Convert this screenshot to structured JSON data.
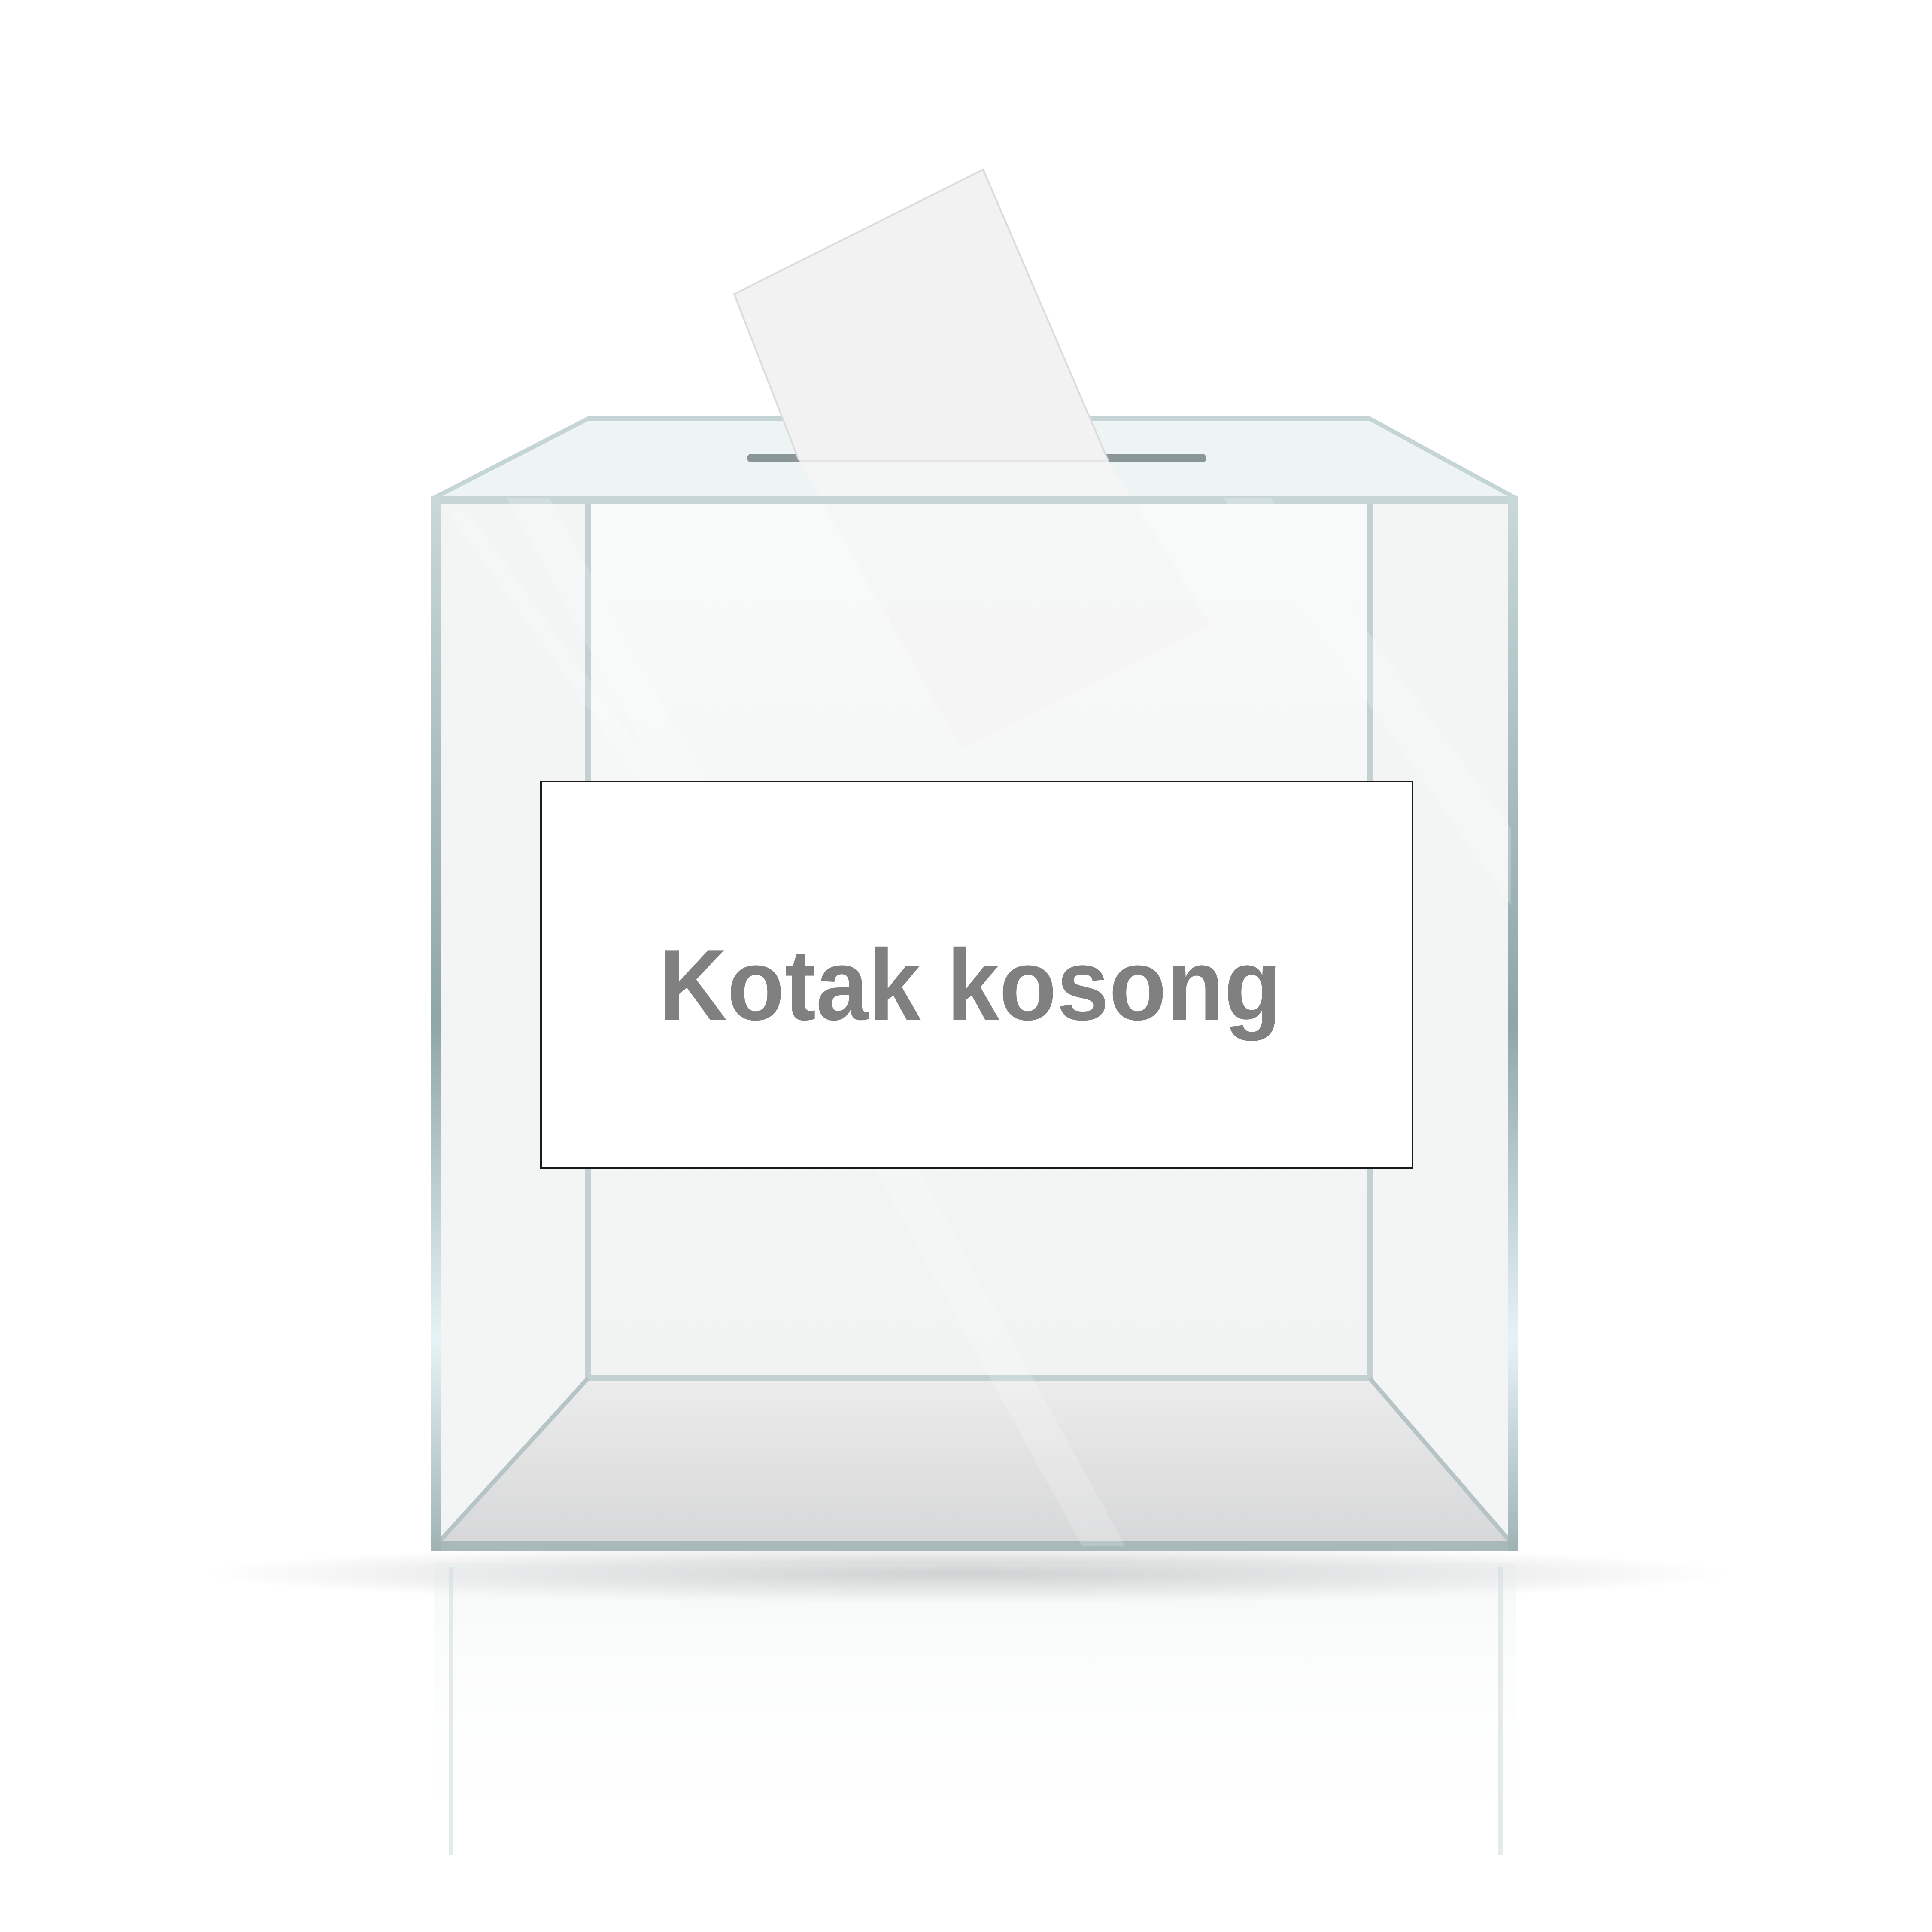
{
  "illustration": {
    "subject": "transparent-ballot-box",
    "label_text": "Kotak kosong",
    "colors": {
      "background": "#ffffff",
      "glass_edge": "#a9bcbf",
      "glass_edge_dark": "#7f9497",
      "label_text": "#808080",
      "label_border": "#1a1a1a",
      "ballot_paper": "#f1f1f1",
      "box_floor": "#dedfe0"
    }
  }
}
